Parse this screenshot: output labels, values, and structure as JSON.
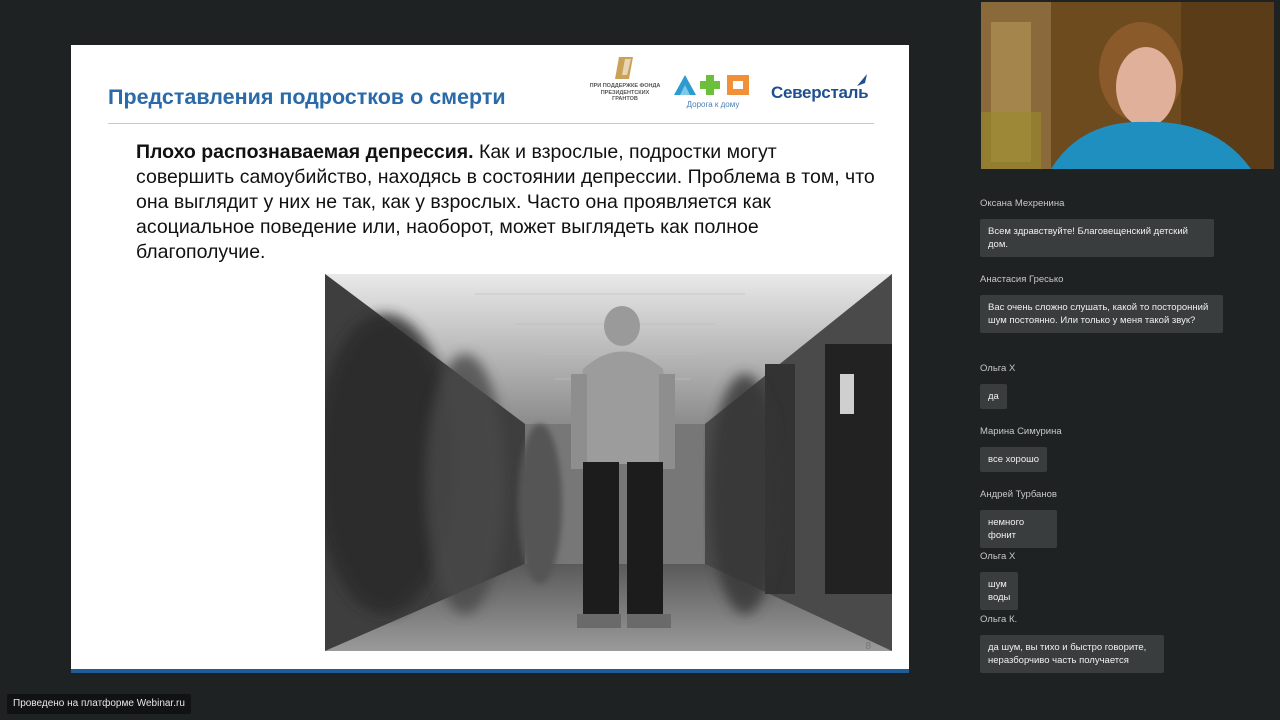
{
  "slide": {
    "title": "Представления подростков о смерти",
    "body_bold": "Плохо распознаваемая депрессия.",
    "body_text": " Как и взрослые, подростки могут совершить самоубийство, находясь в состоянии депрессии. Проблема в том, что она выглядит у них не так, как у взрослых. Часто она проявляется как асоциальное поведение или, наоборот, может выглядеть как полное благополучие.",
    "logos": {
      "fund": "ПРИ ПОДДЕРЖКЕ ФОНДА ПРЕЗИДЕНТСКИХ ГРАНТОВ",
      "doroga": "Дорога к дому",
      "severstal": "Северсталь"
    },
    "page_number": "8"
  },
  "chat": {
    "messages": [
      {
        "author": "Оксана Мехренина",
        "text": "Всем здравствуйте! Благовещенский детский дом."
      },
      {
        "author": "Анастасия Гресько",
        "text": "Вас очень сложно слушать, какой то посторонний шум постоянно. Или только у меня такой звук?"
      },
      {
        "author": "Ольга Х",
        "text": "да"
      },
      {
        "author": "Марина Симурина",
        "text": "все хорошо"
      },
      {
        "author": "Андрей Турбанов",
        "text": "немного фонит"
      },
      {
        "author": "Ольга Х",
        "text": "шум воды"
      },
      {
        "author": "Ольга К.",
        "text": "да шум, вы тихо и быстро говорите, неразборчиво часть получается"
      }
    ]
  },
  "footer": {
    "platform_badge": "Проведено на платформе Webinar.ru"
  },
  "colors": {
    "title_blue": "#2a6aa8",
    "background": "#1f2222",
    "bubble": "#3a3d3d"
  }
}
